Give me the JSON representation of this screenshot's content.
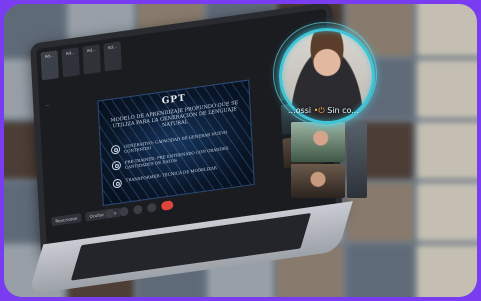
{
  "meeting": {
    "tabs": [
      "Ad...",
      "Ad...",
      "Ad...",
      "Ad..."
    ],
    "presenter_label": "...",
    "speaker_name": "...ossi",
    "speaker_status": "Sin co..."
  },
  "slide": {
    "title": "GPT",
    "subtitle": "MODELO DE APRENDIZAJE PROFUNDO QUE SE UTILIZA PARA LA GENERACIÓN DE LENGUAJE NATURAL",
    "items": [
      "GENERATIVO: CAPACIDAD DE GENERAR NUEVO CONTENIDO",
      "PRE-TRAINED: PRE ENTRENADO CON GRANDES CANTIDADES DE DATOS",
      "TRANSFORMER: TÉCNICA DE MODELIZAR"
    ]
  },
  "controls": {
    "left_chips": [
      "Reaccionar",
      "Ocultar video"
    ]
  },
  "colors": {
    "frame": "#7a3cf0",
    "bubble_ring": "#3ec6d8",
    "end_call": "#e0453b"
  }
}
